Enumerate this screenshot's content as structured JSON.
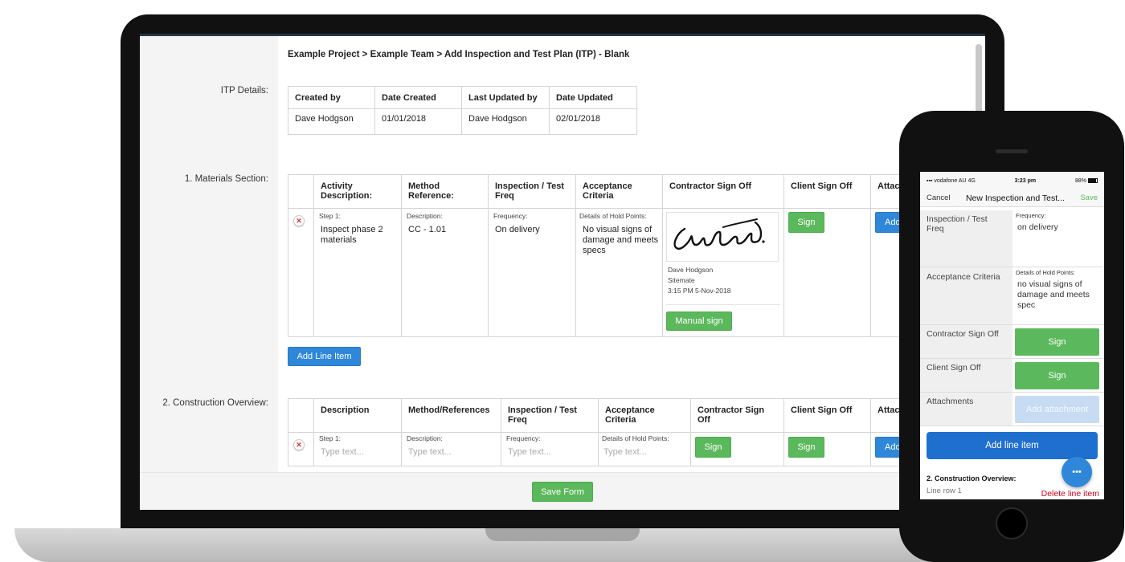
{
  "breadcrumb": "Example Project  >  Example Team  >  Add Inspection and Test Plan (ITP) - Blank",
  "itp": {
    "label": "ITP Details:",
    "headers": [
      "Created by",
      "Date Created",
      "Last Updated by",
      "Date Updated"
    ],
    "row": [
      "Dave Hodgson",
      "01/01/2018",
      "Dave Hodgson",
      "02/01/2018"
    ]
  },
  "materials": {
    "label": "1. Materials Section:",
    "headers": [
      "Activity Description:",
      "Method Reference:",
      "Inspection / Test Freq",
      "Acceptance Criteria",
      "Contractor Sign Off",
      "Client Sign Off",
      "Attac"
    ],
    "row": {
      "step_label": "Step 1:",
      "step_value": "Inspect phase 2 materials",
      "desc_label": "Description:",
      "desc_value": "CC - 1.01",
      "freq_label": "Frequency:",
      "freq_value": "On delivery",
      "hold_label": "Details of Hold Points:",
      "hold_value": "No visual signs of damage and meets specs",
      "signer_name": "Dave Hodgson",
      "signer_company": "Sitemate",
      "signed_at": "3:15 PM 5-Nov-2018",
      "manual_sign": "Manual sign",
      "client_sign": "Sign",
      "add_attachment": "Add"
    },
    "add_line_item": "Add Line Item"
  },
  "construction": {
    "label": "2. Construction Overview:",
    "headers": [
      "Description",
      "Method/References",
      "Inspection / Test Freq",
      "Acceptance Criteria",
      "Contractor Sign Off",
      "Client Sign Off",
      "Attac"
    ],
    "row": {
      "step_label": "Step 1:",
      "desc_label": "Description:",
      "freq_label": "Frequency:",
      "hold_label": "Details of Hold Points:",
      "placeholder": "Type text...",
      "contractor_sign": "Sign",
      "client_sign": "Sign",
      "add_attachment": "Add"
    }
  },
  "save_form": "Save Form",
  "phone": {
    "carrier": "vodafone AU",
    "network": "4G",
    "time": "3:23 pm",
    "battery": "88%",
    "cancel": "Cancel",
    "title": "New Inspection and Test...",
    "save": "Save",
    "freq_label": "Inspection / Test Freq",
    "freq_mini": "Frequency:",
    "freq_value": "on delivery",
    "acc_label": "Acceptance Criteria",
    "acc_mini": "Details of Hold Points:",
    "acc_value": "no visual signs of damage and meets spec",
    "contractor_label": "Contractor Sign Off",
    "client_label": "Client Sign Off",
    "sign": "Sign",
    "attachments_label": "Attachments",
    "add_attachment": "Add attachment",
    "add_line_item": "Add line item",
    "section2": "2. Construction Overview:",
    "line_row": "Line row 1",
    "delete_line": "Delete line item",
    "fab": "•••"
  },
  "colors": {
    "green": "#5cb85c",
    "blue": "#2f87d9",
    "delete_red": "#d9001b"
  }
}
